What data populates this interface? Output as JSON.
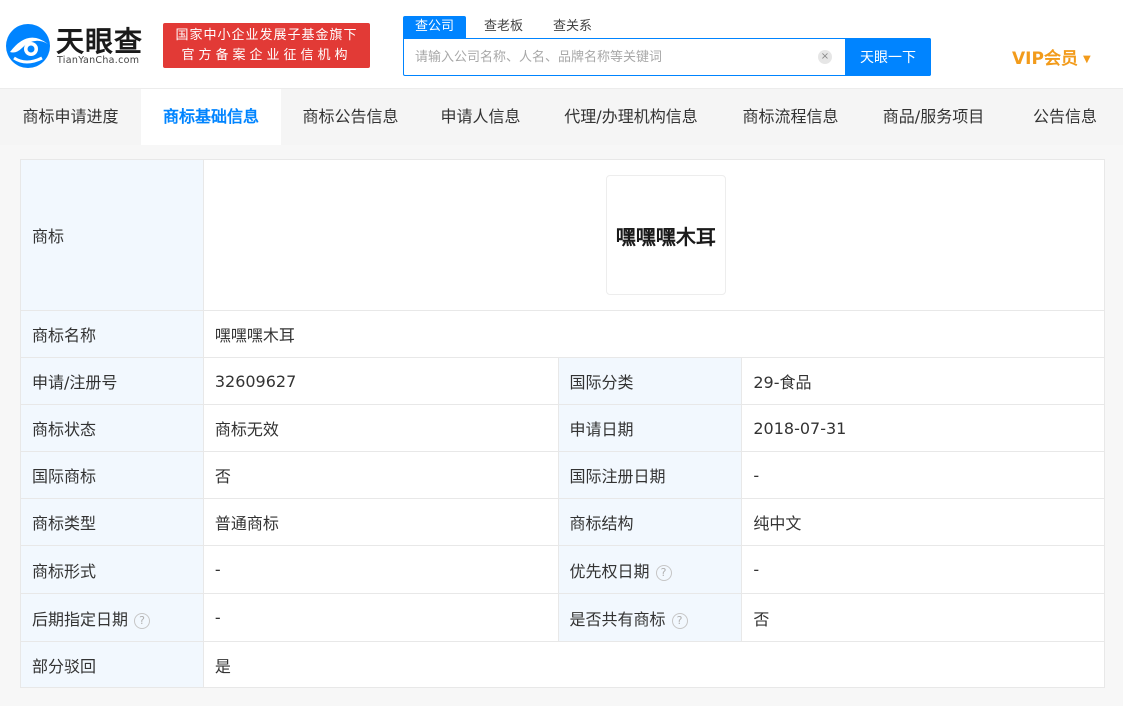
{
  "header": {
    "logo_title": "天眼查",
    "logo_domain": "TianYanCha.com",
    "badge_line1": "国家中小企业发展子基金旗下",
    "badge_line2": "官方备案企业征信机构",
    "search_tabs": [
      "查公司",
      "查老板",
      "查关系"
    ],
    "search_placeholder": "请输入公司名称、人名、品牌名称等关键词",
    "clear_glyph": "×",
    "search_button": "天眼一下",
    "vip_label": "VIP会员",
    "vip_caret": "▼"
  },
  "colors": {
    "brand_blue": "#0084ff",
    "badge_red": "#e23a36",
    "vip_orange": "#f29b1b",
    "label_bg": "#f2f8fe"
  },
  "tabs": [
    {
      "label": "商标申请进度",
      "active": false
    },
    {
      "label": "商标基础信息",
      "active": true
    },
    {
      "label": "商标公告信息",
      "active": false
    },
    {
      "label": "申请人信息",
      "active": false
    },
    {
      "label": "代理/办理机构信息",
      "active": false
    },
    {
      "label": "商标流程信息",
      "active": false
    },
    {
      "label": "商品/服务项目",
      "active": false
    },
    {
      "label": "公告信息",
      "active": false
    }
  ],
  "trademark": {
    "logo_label": "商标",
    "logo_text": "嘿嘿嘿木耳",
    "name_label": "商标名称",
    "name_value": "嘿嘿嘿木耳",
    "rows": [
      {
        "l1": "申请/注册号",
        "v1": "32609627",
        "l2": "国际分类",
        "v2": "29-食品"
      },
      {
        "l1": "商标状态",
        "v1": "商标无效",
        "l2": "申请日期",
        "v2": "2018-07-31"
      },
      {
        "l1": "国际商标",
        "v1": "否",
        "l2": "国际注册日期",
        "v2": "-"
      },
      {
        "l1": "商标类型",
        "v1": "普通商标",
        "l2": "商标结构",
        "v2": "纯中文"
      },
      {
        "l1": "商标形式",
        "v1": "-",
        "l2": "优先权日期",
        "v2": "-"
      },
      {
        "l1": "后期指定日期",
        "v1": "-",
        "l2": "是否共有商标",
        "v2": "否"
      }
    ],
    "last_label": "部分驳回",
    "last_value": "是",
    "help_glyph": "?"
  }
}
